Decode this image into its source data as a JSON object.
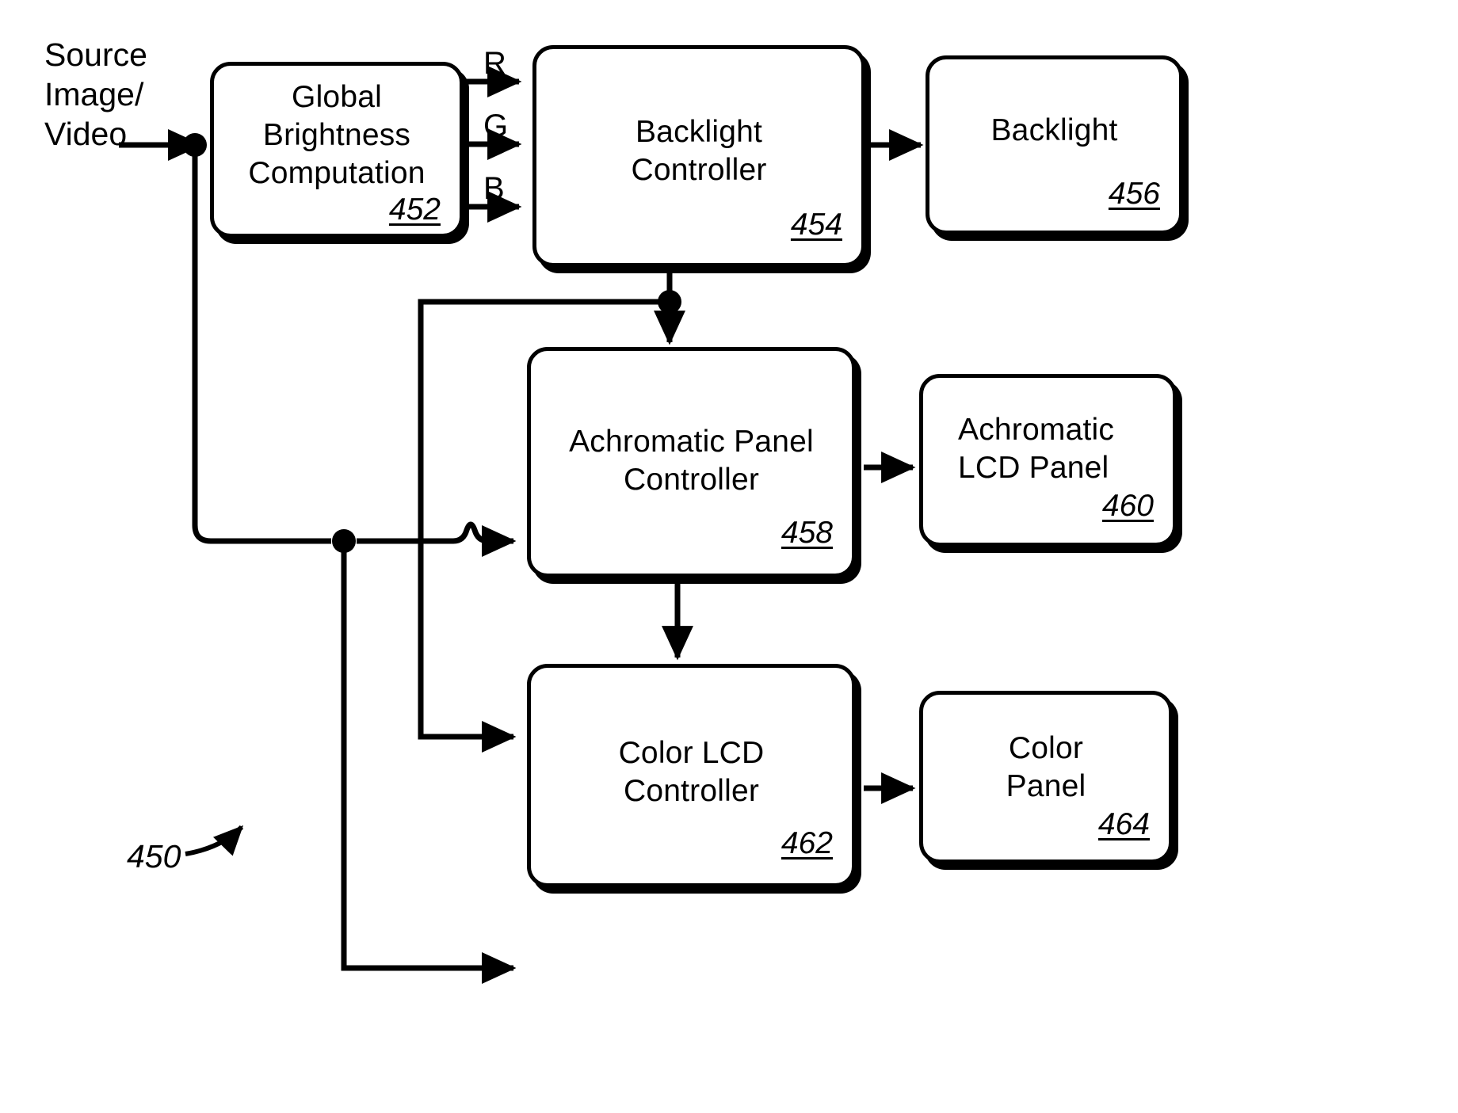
{
  "figure": {
    "reference_numeral": "450",
    "source_label": "Source\nImage/\nVideo",
    "signal_labels": {
      "r": "R",
      "g": "G",
      "b": "B"
    },
    "ink_color": "#000000",
    "background_color": "#ffffff"
  },
  "blocks": [
    {
      "id": "global-brightness-computation",
      "title": "Global\nBrightness\nComputation",
      "ref": "452"
    },
    {
      "id": "backlight-controller",
      "title": "Backlight\nController",
      "ref": "454"
    },
    {
      "id": "backlight",
      "title": "Backlight",
      "ref": "456"
    },
    {
      "id": "achromatic-panel-controller",
      "title": "Achromatic Panel\nController",
      "ref": "458"
    },
    {
      "id": "achromatic-lcd-panel",
      "title": "Achromatic\nLCD Panel",
      "ref": "460"
    },
    {
      "id": "color-lcd-controller",
      "title": "Color LCD\nController",
      "ref": "462"
    },
    {
      "id": "color-panel",
      "title": "Color\nPanel",
      "ref": "464"
    }
  ]
}
